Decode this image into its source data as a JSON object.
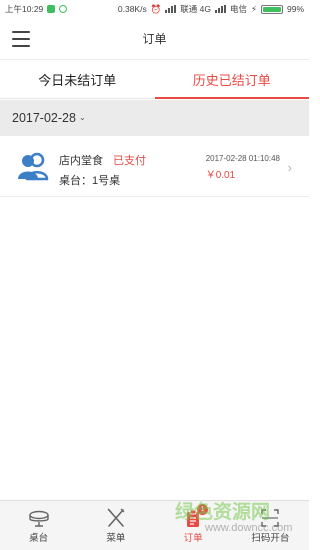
{
  "status_bar": {
    "time": "上午10:29",
    "speed": "0.38K/s",
    "carrier1": "联通 4G",
    "carrier2": "电信",
    "battery": "99%",
    "battery_level": 0.99
  },
  "nav": {
    "title": "订单",
    "menu_icon": "hamburger-menu-icon"
  },
  "tabs": [
    {
      "label": "今日未结订单",
      "active": false
    },
    {
      "label": "历史已结订单",
      "active": true
    }
  ],
  "date_filter": {
    "value": "2017-02-28",
    "chevron": "⌄"
  },
  "orders": [
    {
      "icon": "users-icon",
      "type": "店内堂食",
      "status": "已支付",
      "table": "桌台：1号桌",
      "time": "2017-02-28 01:10:48",
      "amount": "￥0.01",
      "chevron": "›"
    }
  ],
  "tabbar": {
    "items": [
      {
        "label": "桌台",
        "icon": "table-icon",
        "active": false
      },
      {
        "label": "菜单",
        "icon": "utensils-icon",
        "active": false
      },
      {
        "label": "订单",
        "icon": "order-icon",
        "active": true,
        "badge": "1"
      },
      {
        "label": "扫码开台",
        "icon": "scan-icon",
        "active": false
      }
    ]
  },
  "watermark": {
    "text": "绿色资源网",
    "url": "www.downcc.com"
  },
  "colors": {
    "accent": "#e84a44",
    "icon_blue": "#3d7fc4",
    "date_bar_bg": "#ebebeb"
  }
}
